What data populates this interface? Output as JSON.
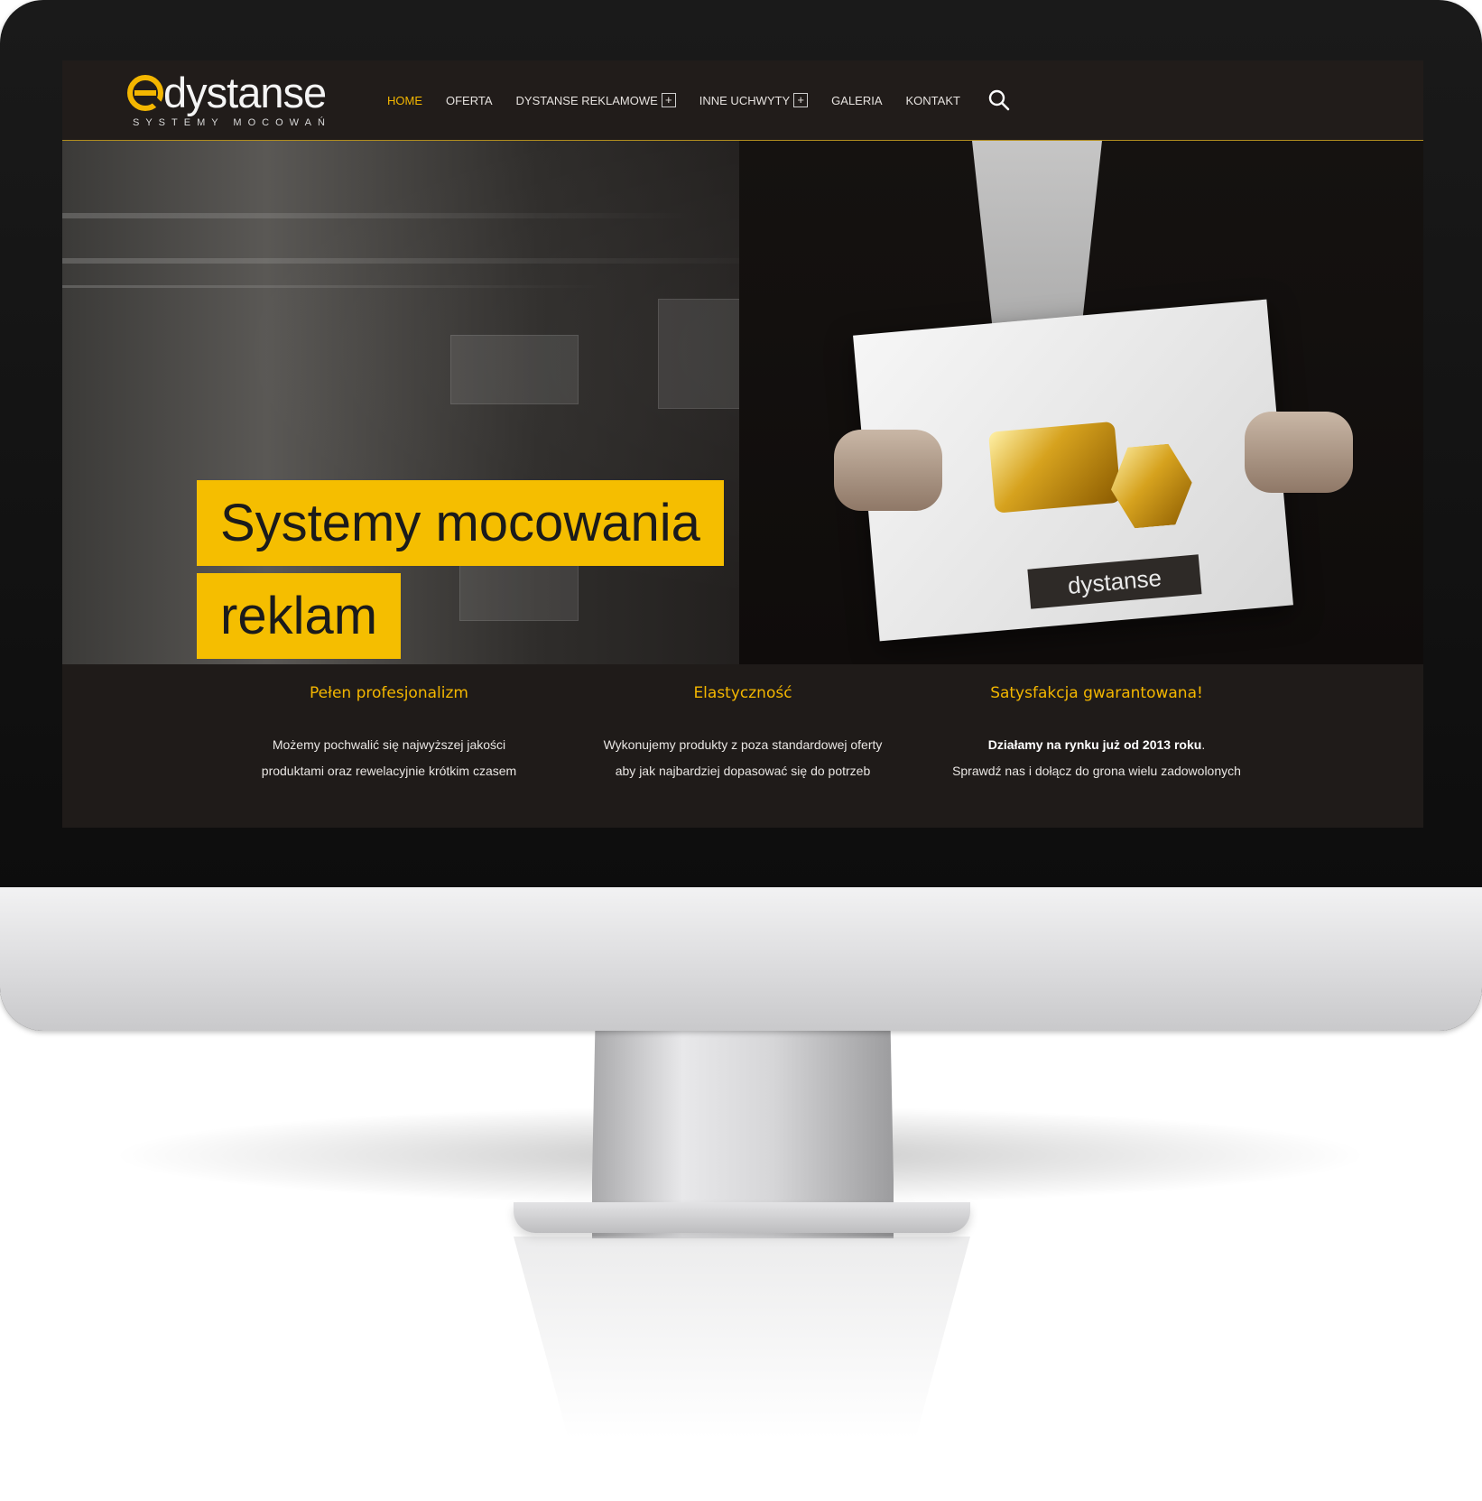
{
  "logo": {
    "word": "dystanse",
    "tagline": "SYSTEMY MOCOWAŃ"
  },
  "nav": {
    "items": [
      {
        "label": "HOME",
        "active": true
      },
      {
        "label": "OFERTA"
      },
      {
        "label": "DYSTANSE REKLAMOWE",
        "expand": "+"
      },
      {
        "label": "INNE UCHWYTY",
        "expand": "+"
      },
      {
        "label": "GALERIA"
      },
      {
        "label": "KONTAKT"
      }
    ],
    "search_icon": "search-icon"
  },
  "hero": {
    "line1": "Systemy mocowania",
    "line2": "reklam",
    "card_logo": "dystanse"
  },
  "features": [
    {
      "title": "Pełen profesjonalizm",
      "lines": [
        "Możemy pochwalić się najwyższej jakości",
        "produktami oraz rewelacyjnie krótkim czasem"
      ]
    },
    {
      "title": "Elastyczność",
      "lines": [
        "Wykonujemy produkty z poza standardowej oferty",
        "aby jak najbardziej dopasować się do potrzeb"
      ]
    },
    {
      "title": "Satysfakcja gwarantowana!",
      "bold": "Działamy na rynku już od 2013 roku",
      "after_bold": ".",
      "lines": [
        "Sprawdź nas i dołącz do grona wielu zadowolonych"
      ]
    }
  ],
  "colors": {
    "accent": "#f5be00",
    "nav_active": "#f3b600",
    "background": "#1e1a18"
  }
}
